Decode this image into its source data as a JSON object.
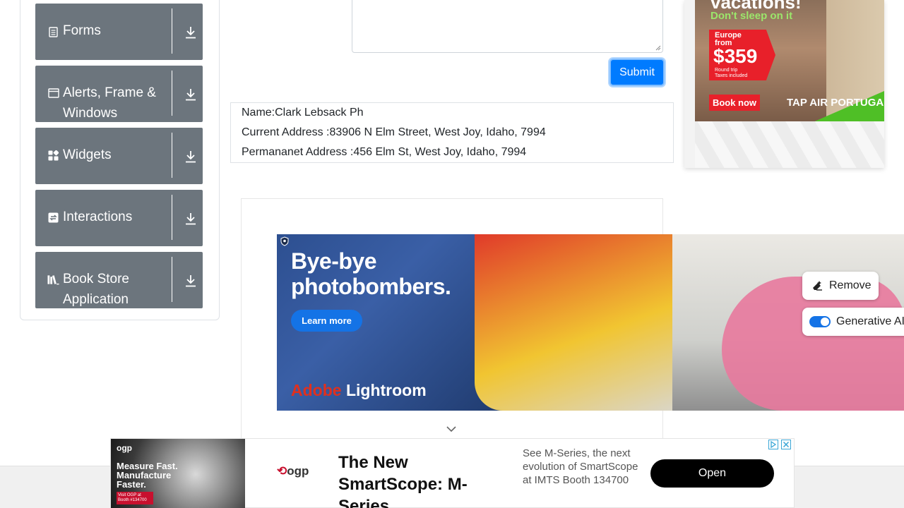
{
  "sidebar": {
    "groups": [
      {
        "label": "Forms",
        "icon": "form-icon"
      },
      {
        "label": "Alerts, Frame & Windows",
        "icon": "window-icon"
      },
      {
        "label": "Widgets",
        "icon": "widgets-icon"
      },
      {
        "label": "Interactions",
        "icon": "interactions-icon"
      },
      {
        "label": "Book Store Application",
        "icon": "book-store-icon"
      }
    ]
  },
  "form": {
    "submit_label": "Submit"
  },
  "output": {
    "name": "Name:Clark Lebsack Ph",
    "current_address": "Current Address :83906 N Elm Street, West Joy, Idaho, 7994",
    "permanent_address": "Permananet Address :456 Elm St, West Joy, Idaho, 7994"
  },
  "ad_top": {
    "headline": "vacations!",
    "subline": "Don't sleep on it",
    "price_caption": "Europe\nfrom",
    "price": "$359",
    "price_terms": "Round trip\nTaxes included",
    "cta": "Book now",
    "brand": "TAP AIR PORTUGAL"
  },
  "ad_lightroom": {
    "headline_line1": "Bye-bye",
    "headline_line2": "photobombers.",
    "cta": "Learn more",
    "brand_a": "Adobe",
    "brand_b": " Lightroom",
    "chip_remove": "Remove",
    "chip_generative": "Generative AI"
  },
  "ad_bottom": {
    "img_logo": "ogp",
    "img_tagline": "Measure Fast.\nManufacture\nFaster.",
    "img_visit": "Visit OGP at\nBooth #134700",
    "logo": "ogp",
    "title": "The New SmartScope: M-Series",
    "description": "See M-Series, the next evolution of SmartScope at IMTS Booth 134700",
    "cta": "Open"
  },
  "colors": {
    "primary": "#007bff",
    "sidebar_group": "#6c757d",
    "ad_red": "#e8202a",
    "ad_green": "#4fbf26",
    "adobe_red": "#e0301e"
  }
}
